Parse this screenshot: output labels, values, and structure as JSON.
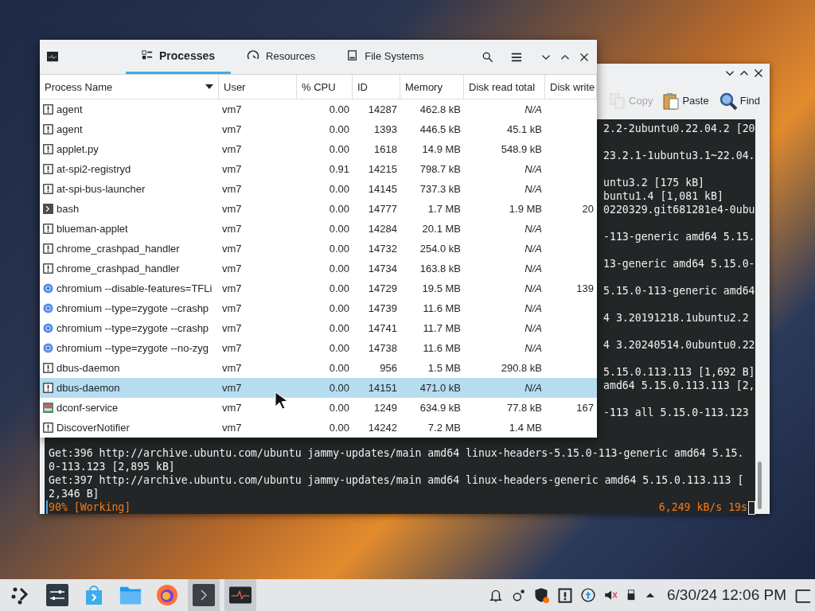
{
  "terminal": {
    "toolbar": [
      {
        "label": "Copy",
        "kind": "copy",
        "disabled": true
      },
      {
        "label": "Paste",
        "kind": "paste",
        "disabled": false
      },
      {
        "label": "Find",
        "kind": "find",
        "disabled": false
      }
    ],
    "output_tails": [
      [
        "2.2-2ubuntu0.22.04.2 [20"
      ],
      [
        "23.2.1-1ubuntu3.1~22.04."
      ],
      [
        "untu3.2 [175 kB]",
        "buntu1.4 [1,081 kB]",
        "0220329.git681281e4-0ubu"
      ],
      [
        "-113-generic amd64 5.15."
      ],
      [
        "13-generic amd64 5.15.0-"
      ],
      [
        "5.15.0-113-generic amd64"
      ],
      [
        "4 3.20191218.1ubuntu2.2"
      ],
      [
        "4 3.20240514.0ubuntu0.22"
      ],
      [
        "5.15.0.113.113 [1,692 B]",
        "amd64 5.15.0.113.113 [2,"
      ],
      [
        "-113 all 5.15.0-113.123"
      ]
    ],
    "output_lines": [
      "Get:396 http://archive.ubuntu.com/ubuntu jammy-updates/main amd64 linux-headers-5.15.0-113-generic amd64 5.15.",
      "0-113.123 [2,895 kB]",
      "Get:397 http://archive.ubuntu.com/ubuntu jammy-updates/main amd64 linux-headers-generic amd64 5.15.0.113.113 [",
      "2,346 B]"
    ],
    "progress": "90% [Working]",
    "rate": "6,249 kB/s 19s"
  },
  "monitor": {
    "tabs": [
      {
        "label": "Processes",
        "kind": "list",
        "selected": true
      },
      {
        "label": "Resources",
        "kind": "gauge",
        "selected": false
      },
      {
        "label": "File Systems",
        "kind": "disk",
        "selected": false
      }
    ],
    "columns": [
      "Process Name",
      "User",
      "% CPU",
      "ID",
      "Memory",
      "Disk read total",
      "Disk write"
    ],
    "rows": [
      {
        "kind": "generic",
        "cells": [
          "agent",
          "vm7",
          "0.00",
          "14287",
          "462.8 kB",
          "N/A",
          ""
        ],
        "selected": false
      },
      {
        "kind": "generic",
        "cells": [
          "agent",
          "vm7",
          "0.00",
          "1393",
          "446.5 kB",
          "45.1 kB",
          ""
        ],
        "selected": false
      },
      {
        "kind": "generic",
        "cells": [
          "applet.py",
          "vm7",
          "0.00",
          "1618",
          "14.9 MB",
          "548.9 kB",
          ""
        ],
        "selected": false
      },
      {
        "kind": "generic",
        "cells": [
          "at-spi2-registryd",
          "vm7",
          "0.91",
          "14215",
          "798.7 kB",
          "N/A",
          ""
        ],
        "selected": false
      },
      {
        "kind": "generic",
        "cells": [
          "at-spi-bus-launcher",
          "vm7",
          "0.00",
          "14145",
          "737.3 kB",
          "N/A",
          ""
        ],
        "selected": false
      },
      {
        "kind": "terminal",
        "cells": [
          "bash",
          "vm7",
          "0.00",
          "14777",
          "1.7 MB",
          "1.9 MB",
          "20"
        ],
        "selected": false
      },
      {
        "kind": "generic",
        "cells": [
          "blueman-applet",
          "vm7",
          "0.00",
          "14284",
          "20.1 MB",
          "N/A",
          ""
        ],
        "selected": false
      },
      {
        "kind": "generic",
        "cells": [
          "chrome_crashpad_handler",
          "vm7",
          "0.00",
          "14732",
          "254.0 kB",
          "N/A",
          ""
        ],
        "selected": false
      },
      {
        "kind": "generic",
        "cells": [
          "chrome_crashpad_handler",
          "vm7",
          "0.00",
          "14734",
          "163.8 kB",
          "N/A",
          ""
        ],
        "selected": false
      },
      {
        "kind": "chromium",
        "cells": [
          "chromium --disable-features=TFLi",
          "vm7",
          "0.00",
          "14729",
          "19.5 MB",
          "N/A",
          "139"
        ],
        "selected": false
      },
      {
        "kind": "chromium",
        "cells": [
          "chromium --type=zygote --crashp",
          "vm7",
          "0.00",
          "14739",
          "11.6 MB",
          "N/A",
          ""
        ],
        "selected": false
      },
      {
        "kind": "chromium",
        "cells": [
          "chromium --type=zygote --crashp",
          "vm7",
          "0.00",
          "14741",
          "11.7 MB",
          "N/A",
          ""
        ],
        "selected": false
      },
      {
        "kind": "chromium",
        "cells": [
          "chromium --type=zygote --no-zyg",
          "vm7",
          "0.00",
          "14738",
          "11.6 MB",
          "N/A",
          ""
        ],
        "selected": false
      },
      {
        "kind": "generic",
        "cells": [
          "dbus-daemon",
          "vm7",
          "0.00",
          "956",
          "1.5 MB",
          "290.8 kB",
          ""
        ],
        "selected": false
      },
      {
        "kind": "generic",
        "cells": [
          "dbus-daemon",
          "vm7",
          "0.00",
          "14151",
          "471.0 kB",
          "N/A",
          ""
        ],
        "selected": true
      },
      {
        "kind": "settings",
        "cells": [
          "dconf-service",
          "vm7",
          "0.00",
          "1249",
          "634.9 kB",
          "77.8 kB",
          "167"
        ],
        "selected": false
      },
      {
        "kind": "generic",
        "cells": [
          "DiscoverNotifier",
          "vm7",
          "0.00",
          "14242",
          "7.2 MB",
          "1.4 MB",
          ""
        ],
        "selected": false
      }
    ]
  },
  "taskbar": {
    "apps": [
      {
        "kind": "launcher",
        "active": false
      },
      {
        "kind": "settings",
        "active": false
      },
      {
        "kind": "store",
        "active": false
      },
      {
        "kind": "folder",
        "active": false
      },
      {
        "kind": "browser",
        "active": false
      },
      {
        "kind": "terminal",
        "active": true
      },
      {
        "kind": "monitor",
        "active": true
      }
    ],
    "clock": "6/30/24 12:06 PM"
  }
}
